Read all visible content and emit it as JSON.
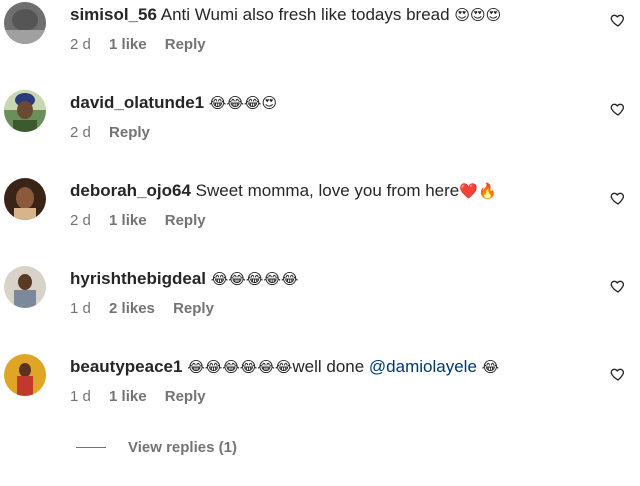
{
  "comments": [
    {
      "username": "simisol_56",
      "text": "Anti Wumi also fresh like todays bread",
      "emojis": "😍😍😍",
      "time": "2 d",
      "likes": "1 like",
      "reply": "Reply"
    },
    {
      "username": "david_olatunde1",
      "text": "",
      "emojis": "😂😂😂😍",
      "time": "2 d",
      "likes": "",
      "reply": "Reply"
    },
    {
      "username": "deborah_ojo64",
      "text": "Sweet momma, love you from here",
      "emojis": "❤️🔥",
      "time": "2 d",
      "likes": "1 like",
      "reply": "Reply"
    },
    {
      "username": "hyrishthebigdeal",
      "text": "",
      "emojis": "😂😂😂😂😂",
      "time": "1 d",
      "likes": "2 likes",
      "reply": "Reply"
    },
    {
      "username": "beautypeace1",
      "text_before": "😂😂😂😂😂😂",
      "text": "well done",
      "mention": "@damiolayele",
      "emojis": "😂",
      "time": "1 d",
      "likes": "1 like",
      "reply": "Reply"
    }
  ],
  "view_replies": "View replies (1)",
  "colors": {
    "text": "#262626",
    "meta": "#737373",
    "mention": "#00376b"
  },
  "icons": {
    "like": "heart-outline-icon"
  }
}
